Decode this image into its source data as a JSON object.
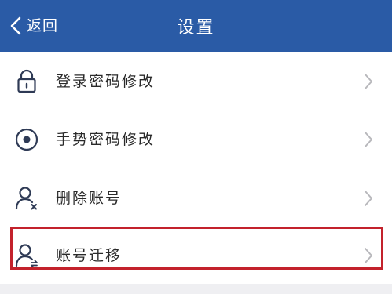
{
  "nav": {
    "back_label": "返回",
    "title": "设置"
  },
  "settings": {
    "items": [
      {
        "label": "登录密码修改",
        "icon": "lock-icon"
      },
      {
        "label": "手势密码修改",
        "icon": "gesture-icon"
      },
      {
        "label": "删除账号",
        "icon": "user-remove-icon"
      },
      {
        "label": "账号迁移",
        "icon": "user-transfer-icon"
      }
    ]
  },
  "colors": {
    "nav_background": "#2a5ba6",
    "highlight_border": "#c3222c",
    "icon_stroke": "#2e3a55",
    "chevron": "#b8b8bc"
  }
}
